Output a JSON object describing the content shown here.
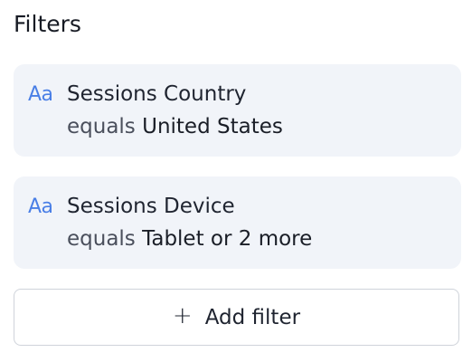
{
  "panel": {
    "title": "Filters"
  },
  "filters": [
    {
      "type_icon_glyph": "Aa",
      "type_icon_name": "text-type-icon",
      "name": "Sessions Country",
      "operator": "equals",
      "value": "United States"
    },
    {
      "type_icon_glyph": "Aa",
      "type_icon_name": "text-type-icon",
      "name": "Sessions Device",
      "operator": "equals",
      "value": "Tablet or 2 more"
    }
  ],
  "add_button": {
    "icon": "plus-icon",
    "icon_glyph": "+",
    "label": "Add filter"
  },
  "colors": {
    "card_background": "#f1f4f9",
    "type_icon": "#4a7fe6",
    "button_border": "#cfd3da"
  }
}
